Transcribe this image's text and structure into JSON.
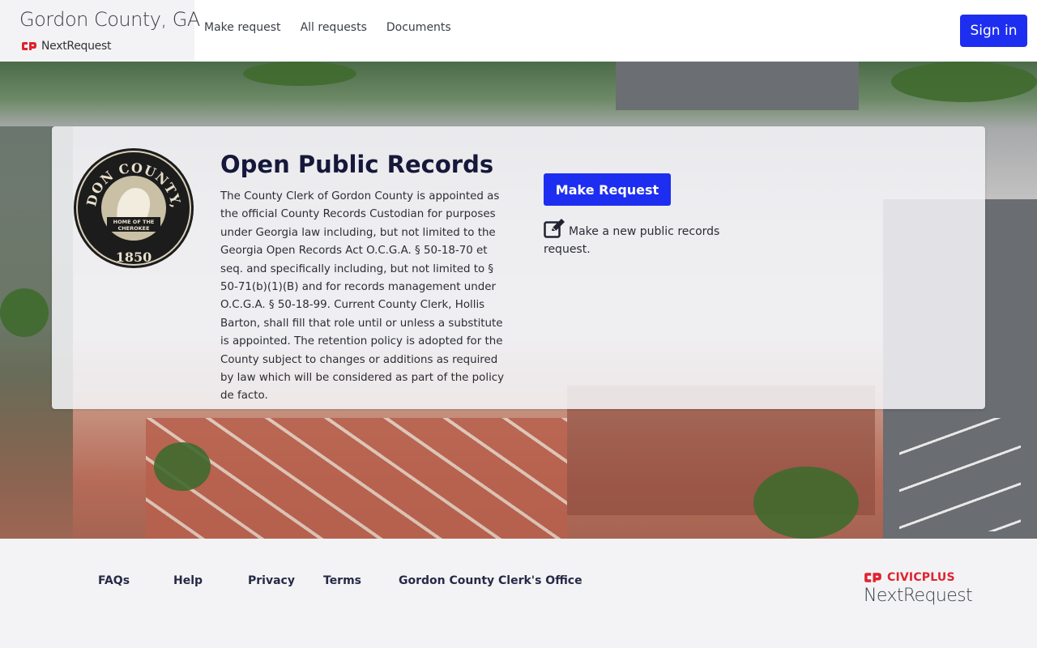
{
  "header": {
    "site_title": "Gordon County, GA",
    "brand_name": "NextRequest",
    "nav": [
      "Make request",
      "All requests",
      "Documents"
    ],
    "sign_in_label": "Sign in"
  },
  "hero": {
    "title": "Open Public Records",
    "description": "The County Clerk of Gordon County is appointed as the official County Records Custodian for purposes under Georgia law including, but not limited to the Georgia Open Records Act O.C.G.A. § 50-18-70 et seq. and specifically including, but not limited to § 50-71(b)(1)(B) and for records management under O.C.G.A. § 50-18-99. Current County Clerk, Hollis Barton, shall fill that role until or unless a substitute is appointed. The retention policy is adopted for the County subject to changes or additions as required by law which will be considered as part of the policy de facto.",
    "make_request_label": "Make Request",
    "make_request_note": "Make a new public records request.",
    "seal": {
      "top_text": "GORDON COUNTY, GA.",
      "middle_text_1": "HOME OF THE",
      "middle_text_2": "CHEROKEE",
      "year": "1850"
    }
  },
  "footer": {
    "links": [
      "FAQs",
      "Help",
      "Privacy",
      "Terms",
      "Gordon County Clerk's Office"
    ],
    "civic_brand": "CIVICPLUS",
    "product_name": "NextRequest"
  },
  "colors": {
    "primary": "#1e2ef0",
    "title_navy": "#15183a",
    "brand_red": "#e0232f",
    "footer_bg": "#f3f3f5"
  },
  "icons": [
    "civicplus-logo-icon",
    "edit-icon"
  ]
}
